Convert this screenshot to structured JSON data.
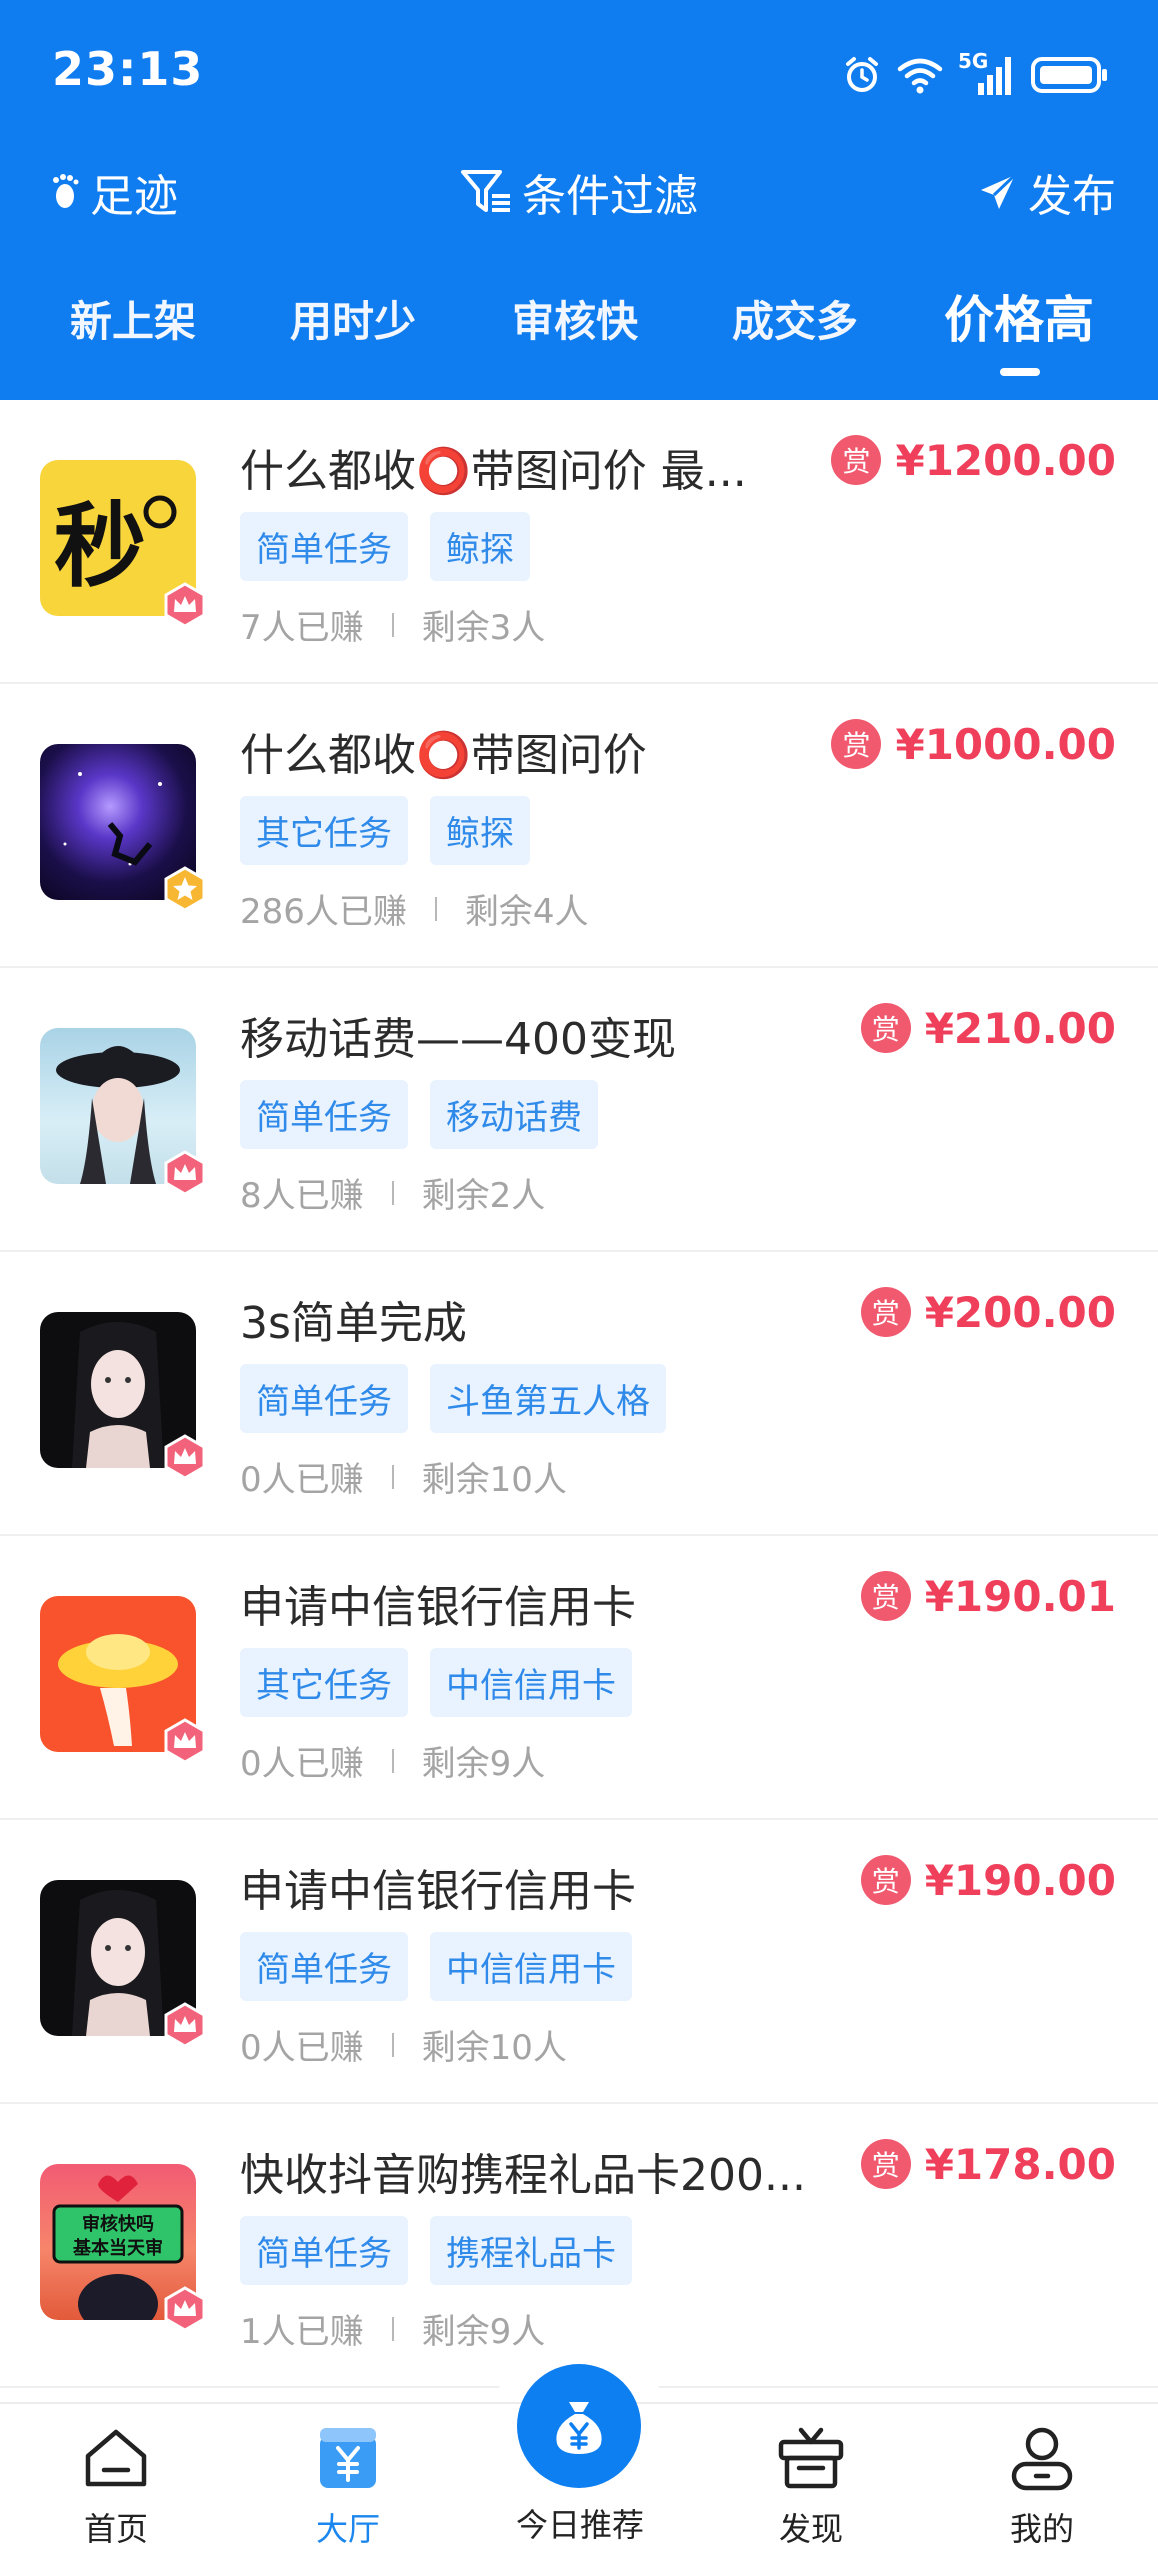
{
  "status_bar": {
    "time": "23:13",
    "network": "5G"
  },
  "toolbar": {
    "footprint_label": "足迹",
    "filter_label": "条件过滤",
    "publish_label": "发布"
  },
  "sort_tabs": [
    {
      "label": "新上架"
    },
    {
      "label": "用时少"
    },
    {
      "label": "审核快"
    },
    {
      "label": "成交多"
    },
    {
      "label": "价格高",
      "active": true
    }
  ],
  "tasks": [
    {
      "title": "什么都收⭕带图问价 最...",
      "price": "¥1200.00",
      "reward_tag": "赏",
      "tags": [
        "简单任务",
        "鲸探"
      ],
      "earned": "7人已赚",
      "remaining": "剩余3人",
      "badge": "crown"
    },
    {
      "title": "什么都收⭕带图问价",
      "price": "¥1000.00",
      "reward_tag": "赏",
      "tags": [
        "其它任务",
        "鲸探"
      ],
      "earned": "286人已赚",
      "remaining": "剩余4人",
      "badge": "star"
    },
    {
      "title": "移动话费——400变现",
      "price": "¥210.00",
      "reward_tag": "赏",
      "tags": [
        "简单任务",
        "移动话费"
      ],
      "earned": "8人已赚",
      "remaining": "剩余2人",
      "badge": "crown"
    },
    {
      "title": "3s简单完成",
      "price": "¥200.00",
      "reward_tag": "赏",
      "tags": [
        "简单任务",
        "斗鱼第五人格"
      ],
      "earned": "0人已赚",
      "remaining": "剩余10人",
      "badge": "crown"
    },
    {
      "title": "申请中信银行信用卡",
      "price": "¥190.01",
      "reward_tag": "赏",
      "tags": [
        "其它任务",
        "中信信用卡"
      ],
      "earned": "0人已赚",
      "remaining": "剩余9人",
      "badge": "crown"
    },
    {
      "title": "申请中信银行信用卡",
      "price": "¥190.00",
      "reward_tag": "赏",
      "tags": [
        "简单任务",
        "中信信用卡"
      ],
      "earned": "0人已赚",
      "remaining": "剩余10人",
      "badge": "crown"
    },
    {
      "title": "快收抖音购携程礼品卡200...",
      "price": "¥178.00",
      "reward_tag": "赏",
      "tags": [
        "简单任务",
        "携程礼品卡"
      ],
      "earned": "1人已赚",
      "remaining": "剩余9人",
      "badge": "crown"
    }
  ],
  "thumb_texts": {
    "miao": "秒",
    "sticker_line1": "审核快吗",
    "sticker_line2": "基本当天审"
  },
  "bottom_nav": {
    "home": "首页",
    "hall": "大厅",
    "today": "今日推荐",
    "discover": "发现",
    "mine": "我的"
  },
  "colors": {
    "primary": "#0f7df0",
    "price": "#ef3f5a",
    "tag_bg": "#e8f3ff",
    "tag_text": "#2f8ae9"
  }
}
